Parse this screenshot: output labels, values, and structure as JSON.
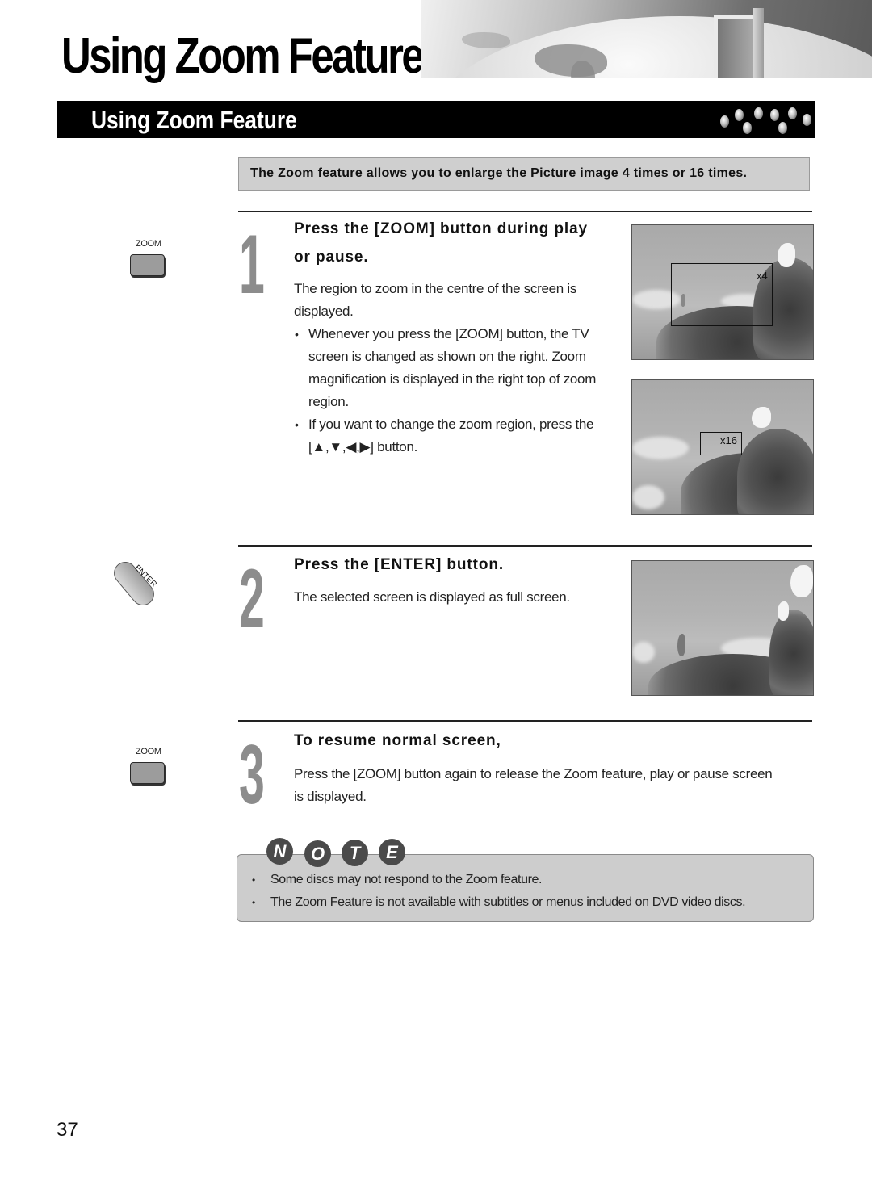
{
  "page": {
    "title": "Using Zoom Feature",
    "page_number": "37"
  },
  "section": {
    "title": "Using Zoom Feature"
  },
  "intro": {
    "text": "The Zoom feature allows you to enlarge the Picture image 4 times or 16 times."
  },
  "steps": [
    {
      "number": "1",
      "remote_button_label": "ZOOM",
      "heading_line1": "Press the [ZOOM] button during play",
      "heading_line2": "or pause.",
      "body": "The region to zoom in the centre of the screen is displayed.",
      "bullets": [
        "Whenever you press the [ZOOM] button, the TV screen is changed as shown on the right. Zoom magnification is displayed in the right top of zoom region.",
        "If you want to change the zoom region, press the [▲,▼,◀,▶] button."
      ],
      "images": [
        {
          "zoom_label": "x4"
        },
        {
          "zoom_label": "x16"
        }
      ]
    },
    {
      "number": "2",
      "remote_button_label": "ENTER",
      "heading": "Press the [ENTER] button.",
      "body": "The selected screen is displayed as full screen."
    },
    {
      "number": "3",
      "remote_button_label": "ZOOM",
      "heading": "To resume normal screen,",
      "body": "Press the [ZOOM] button again to release the Zoom feature, play or pause screen is displayed."
    }
  ],
  "note": {
    "badge_letters": [
      "N",
      "O",
      "T",
      "E"
    ],
    "items": [
      "Some discs may not respond to the Zoom feature.",
      "The Zoom Feature is not available with subtitles or menus included on DVD video discs."
    ]
  }
}
